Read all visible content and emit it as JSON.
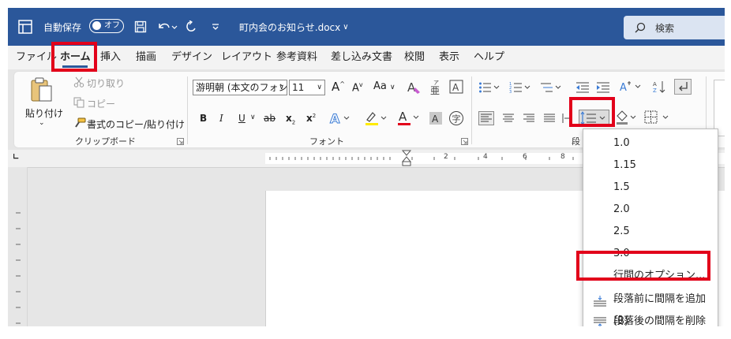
{
  "titlebar": {
    "autosave_label": "自動保存",
    "autosave_state": "オフ",
    "filename": "町内会のお知らせ.docx",
    "filename_caret": "∨",
    "search_placeholder": "検索",
    "bg_color": "#2b579a"
  },
  "tabs": [
    {
      "label": "ファイル"
    },
    {
      "label": "ホーム",
      "active": true
    },
    {
      "label": "挿入"
    },
    {
      "label": "描画"
    },
    {
      "label": "デザイン"
    },
    {
      "label": "レイアウト"
    },
    {
      "label": "参考資料"
    },
    {
      "label": "差し込み文書"
    },
    {
      "label": "校閲"
    },
    {
      "label": "表示"
    },
    {
      "label": "ヘルプ"
    }
  ],
  "clipboard": {
    "paste": "貼り付け",
    "cut": "切り取り",
    "copy": "コピー",
    "format_painter": "書式のコピー/貼り付け",
    "group_label": "クリップボード"
  },
  "font": {
    "font_name": "游明朝 (本文のフォン",
    "font_size": "11",
    "grow": "A",
    "shrink": "A",
    "case": "Aa",
    "bold": "B",
    "italic": "I",
    "underline": "U",
    "strike": "ab",
    "subscript": "x",
    "superscript": "x",
    "sub_mark": "2",
    "sup_mark": "2",
    "highlight_letter": "A",
    "fontcolor_letter": "A",
    "shade_letter": "A",
    "ruby_char": "亜",
    "enclosed_char": "字",
    "boxed_letter": "A",
    "group_label": "フォント"
  },
  "paragraph": {
    "group_label": "段",
    "sort_label": "A Z"
  },
  "ruler": {
    "numbers": [
      "2",
      "4",
      "6",
      "8"
    ]
  },
  "line_spacing_menu": {
    "items": [
      "1.0",
      "1.15",
      "1.5",
      "2.0",
      "2.5",
      "3.0"
    ],
    "options": "行間のオプション...",
    "add_before": "段落前に間隔を追加(B)",
    "remove_after": "段落後の間隔を削除(A)"
  },
  "highlight_color": "#e2001a"
}
